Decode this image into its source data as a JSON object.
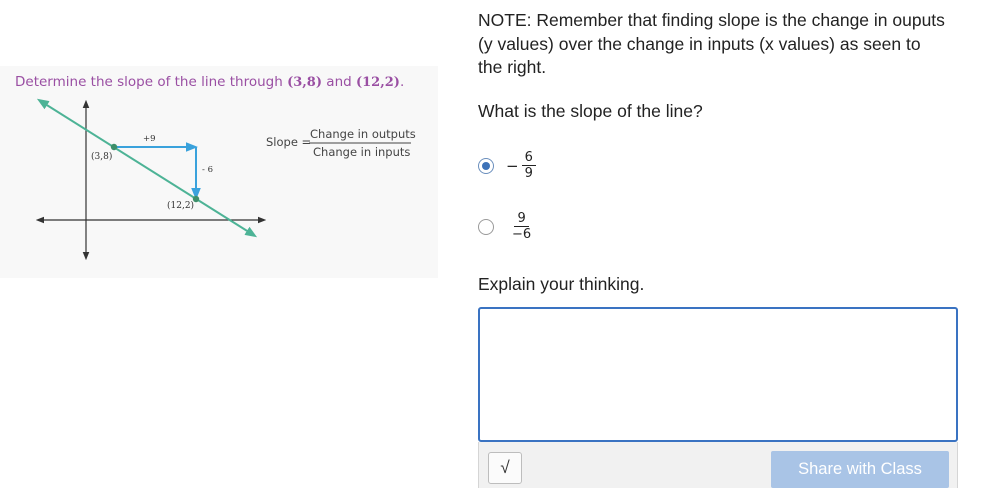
{
  "figure": {
    "title_prefix": "Determine the slope of the line through ",
    "point_a": "(3,8)",
    "title_and": " and ",
    "point_b": "(12,2)",
    "title_end": ".",
    "label_point_a": "(3,8)",
    "label_point_b": "(12,2)",
    "horizontal_change": "+9",
    "vertical_change": "- 6",
    "formula_lhs": "Slope =",
    "formula_numerator": "Change in outputs",
    "formula_denominator": "Change in inputs",
    "colors": {
      "line": "#4db396",
      "arrows": "#3aa2dc",
      "title": "#9a4fa3"
    }
  },
  "note": "NOTE:  Remember that finding slope is the change in ouputs (y values) over the change in inputs (x values) as seen to the right.",
  "question": "What is the slope of the line?",
  "choices": [
    {
      "sign": "−",
      "numerator": "6",
      "denominator": "9",
      "selected": true
    },
    {
      "sign": "",
      "numerator": "9",
      "denominator": "−6",
      "selected": false
    }
  ],
  "explain_label": "Explain your thinking.",
  "answer_text": "",
  "toolbar": {
    "math_icon": "√",
    "share_label": "Share with Class"
  },
  "colors": {
    "accent": "#3a73c2",
    "share_disabled": "#a9c4e6"
  }
}
